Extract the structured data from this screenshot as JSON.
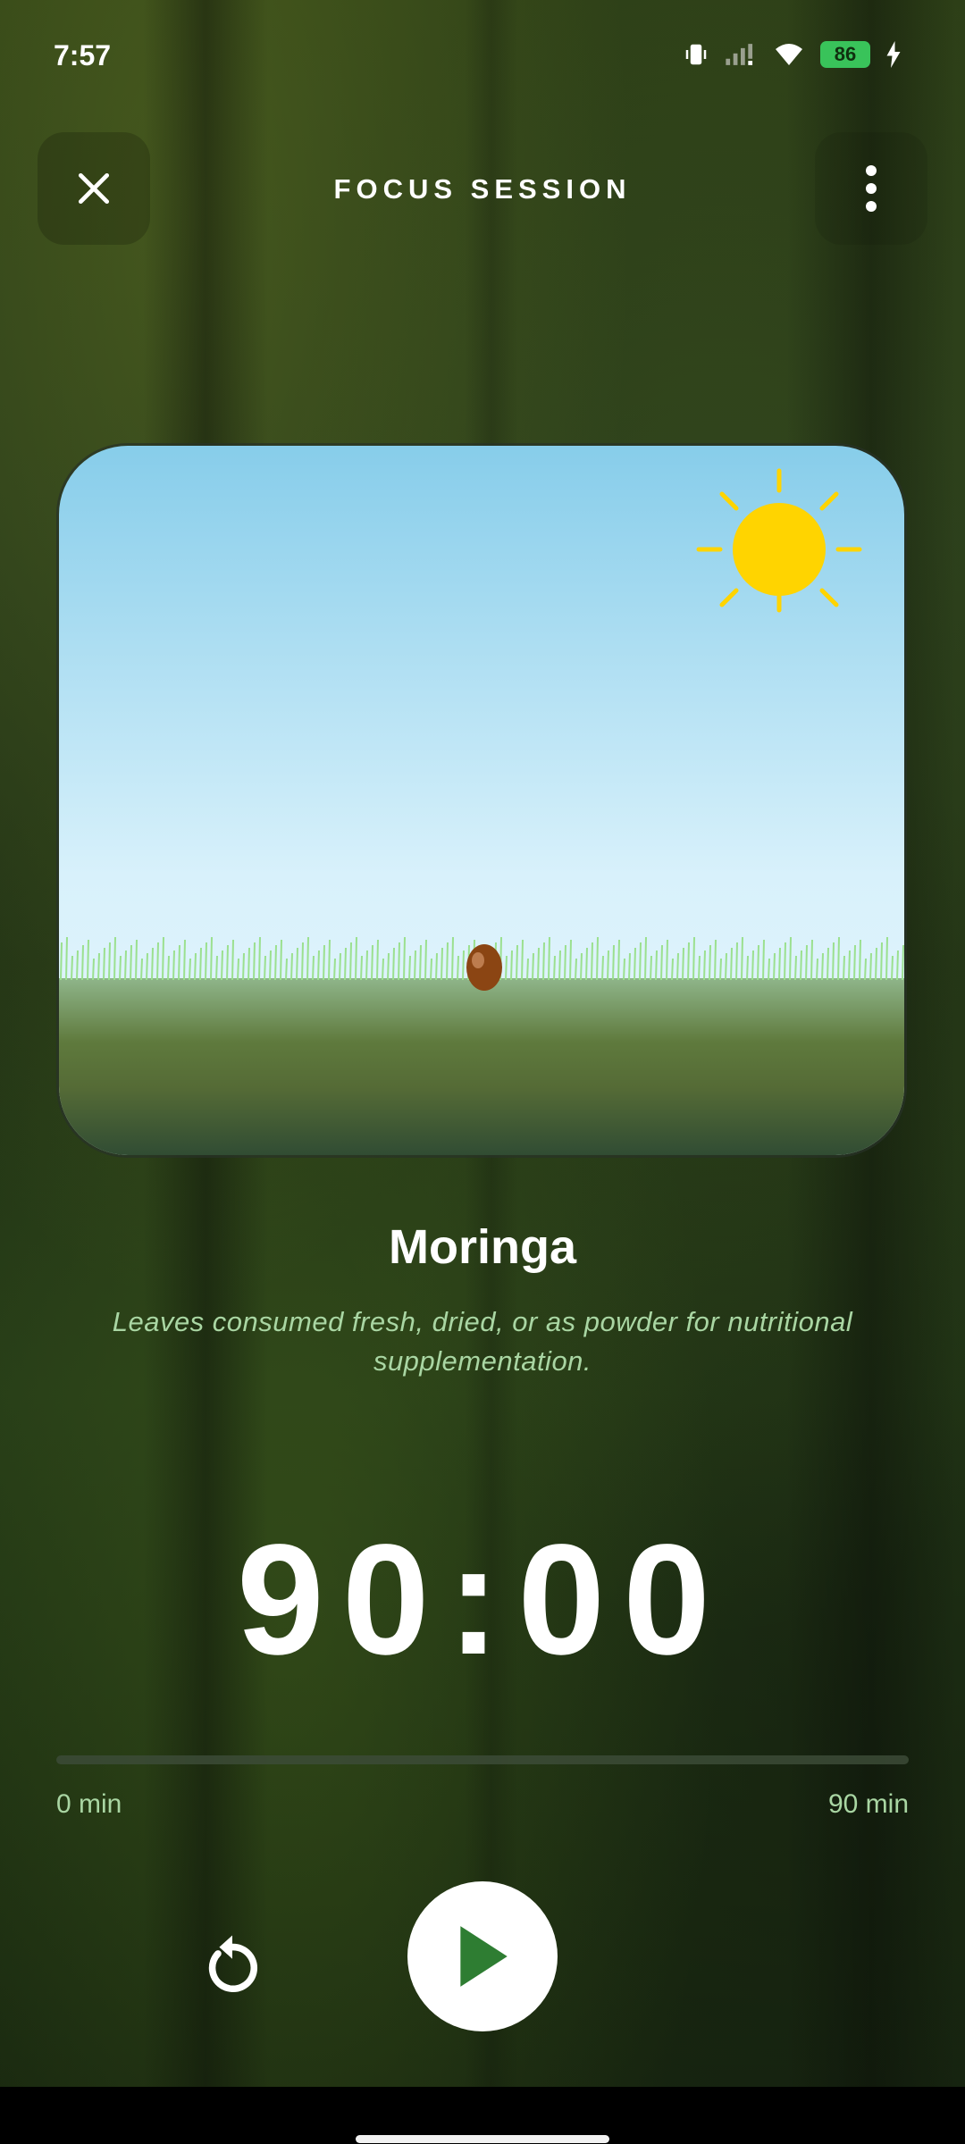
{
  "status_bar": {
    "time": "7:57",
    "battery_level": "86",
    "icons": [
      "vibrate-icon",
      "signal-icon",
      "wifi-icon",
      "battery-icon",
      "charging-icon"
    ]
  },
  "header": {
    "title": "FOCUS SESSION",
    "close_icon": "close-icon",
    "more_icon": "more-vert-icon"
  },
  "plant": {
    "name": "Moringa",
    "description": "Leaves consumed fresh, dried, or as powder for nutritional supplementation."
  },
  "timer": {
    "display": "90:00"
  },
  "progress": {
    "fraction": 0.0,
    "min_label": "0 min",
    "max_label": "90 min"
  },
  "controls": {
    "reset_icon": "reset-icon",
    "play_icon": "play-icon"
  },
  "colors": {
    "accent_green": "#2e7d32",
    "text_green": "#a9d6a3",
    "sun": "#ffd400",
    "sky_top": "#87cdea",
    "seed": "#8b4513"
  }
}
